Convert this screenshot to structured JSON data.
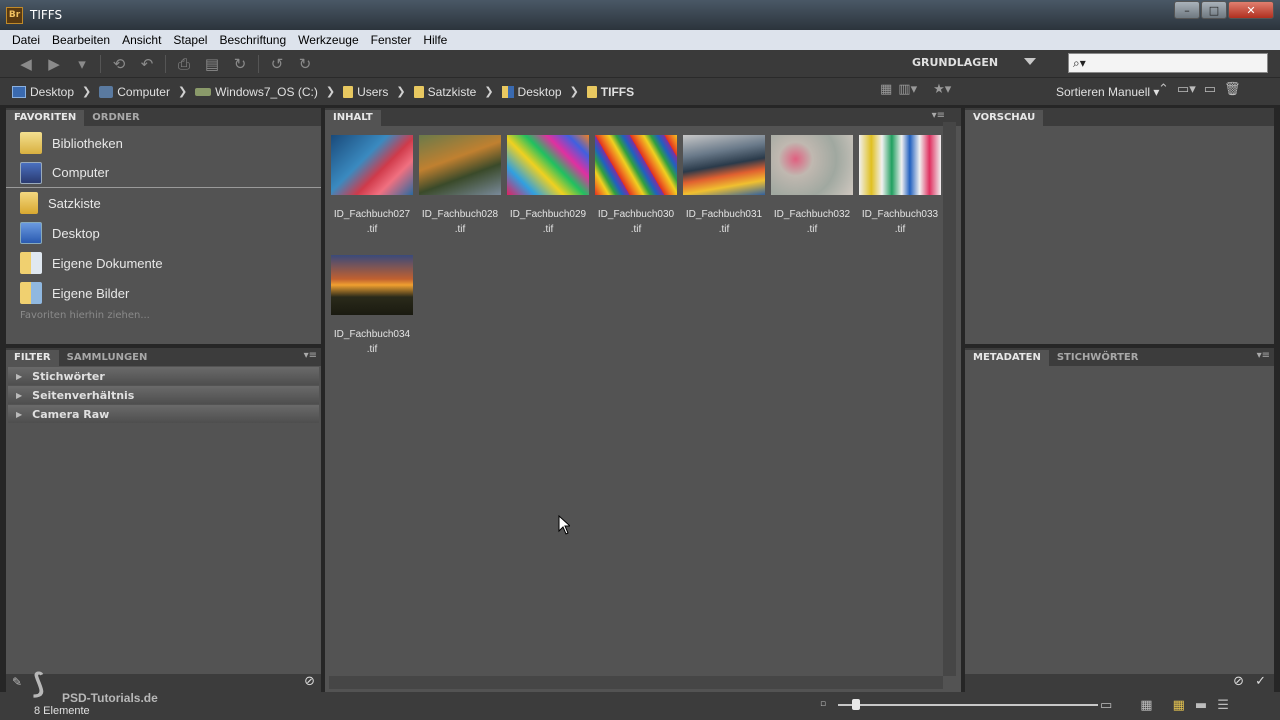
{
  "window": {
    "app_badge": "Br",
    "title": "TIFFS",
    "minimize": "–",
    "maximize": "□",
    "close": "✕"
  },
  "menu": [
    "Datei",
    "Bearbeiten",
    "Ansicht",
    "Stapel",
    "Beschriftung",
    "Werkzeuge",
    "Fenster",
    "Hilfe"
  ],
  "toolbar": {
    "icons": [
      "back-icon",
      "forward-icon",
      "history-icon",
      "boomerang-icon",
      "return-icon",
      "camera-icon",
      "refine-icon",
      "rotate-icon",
      "undo-icon",
      "redo-icon"
    ],
    "workspace": "GRUNDLAGEN",
    "search_placeholder": "⌕▾"
  },
  "path": [
    {
      "label": "Desktop",
      "icon": "desktop"
    },
    {
      "label": "Computer",
      "icon": "computer"
    },
    {
      "label": "Windows7_OS (C:)",
      "icon": "drive"
    },
    {
      "label": "Users",
      "icon": "folder"
    },
    {
      "label": "Satzkiste",
      "icon": "folder"
    },
    {
      "label": "Desktop",
      "icon": "deskfolder"
    },
    {
      "label": "TIFFS",
      "icon": "folder"
    }
  ],
  "sort_label": "Sortieren Manuell ▾",
  "left_top": {
    "tabs": [
      "FAVORITEN",
      "ORDNER"
    ],
    "items": [
      {
        "label": "Bibliotheken",
        "icon": "lib"
      },
      {
        "label": "Computer",
        "icon": "comp"
      },
      {
        "label": "Satzkiste",
        "icon": "folder"
      },
      {
        "label": "Desktop",
        "icon": "desk"
      },
      {
        "label": "Eigene Dokumente",
        "icon": "docs"
      },
      {
        "label": "Eigene Bilder",
        "icon": "pics"
      }
    ],
    "hint": "Favoriten hierhin ziehen..."
  },
  "left_bottom": {
    "tabs": [
      "FILTER",
      "SAMMLUNGEN"
    ],
    "rows": [
      "Stichwörter",
      "Seitenverhältnis",
      "Camera Raw"
    ]
  },
  "content": {
    "tab": "INHALT",
    "thumbs": [
      {
        "name": "ID_Fachbuch027",
        "ext": ".tif"
      },
      {
        "name": "ID_Fachbuch028",
        "ext": ".tif"
      },
      {
        "name": "ID_Fachbuch029",
        "ext": ".tif"
      },
      {
        "name": "ID_Fachbuch030",
        "ext": ".tif"
      },
      {
        "name": "ID_Fachbuch031",
        "ext": ".tif"
      },
      {
        "name": "ID_Fachbuch032",
        "ext": ".tif"
      },
      {
        "name": "ID_Fachbuch033",
        "ext": ".tif"
      },
      {
        "name": "ID_Fachbuch034",
        "ext": ".tif"
      }
    ]
  },
  "right_top": {
    "tabs": [
      "VORSCHAU"
    ]
  },
  "right_bottom": {
    "tabs": [
      "METADATEN",
      "STICHWÖRTER"
    ]
  },
  "status": {
    "count": "8 Elemente",
    "watermark": "PSD-Tutorials.de"
  }
}
